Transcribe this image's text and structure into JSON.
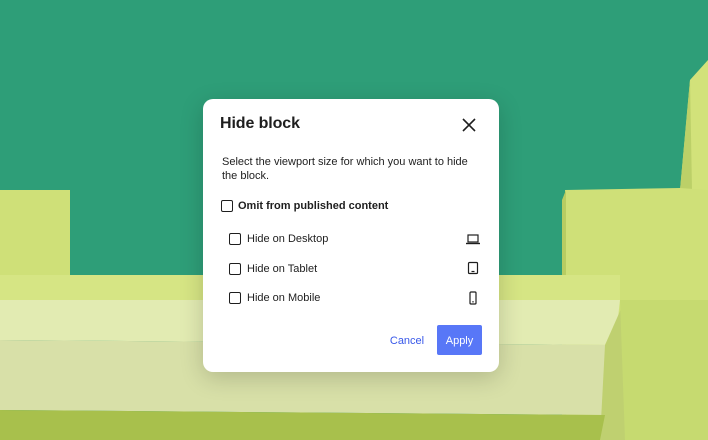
{
  "dialog": {
    "title": "Hide block",
    "description": "Select the viewport size for which you want to hide the block.",
    "omit": {
      "label": "Omit from published content",
      "checked": false
    },
    "options": [
      {
        "label": "Hide on Desktop",
        "checked": false,
        "icon": "laptop-icon"
      },
      {
        "label": "Hide on Tablet",
        "checked": false,
        "icon": "tablet-icon"
      },
      {
        "label": "Hide on Mobile",
        "checked": false,
        "icon": "mobile-icon"
      }
    ],
    "cancel_label": "Cancel",
    "apply_label": "Apply"
  },
  "colors": {
    "background_green": "#2e9e78",
    "wall_yellow": "#c8dc6e",
    "accent_blue": "#3858e9"
  }
}
